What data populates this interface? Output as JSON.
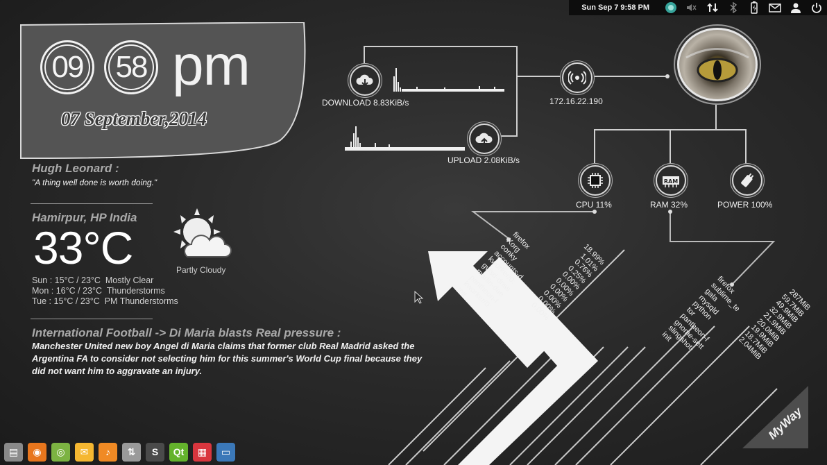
{
  "panel": {
    "clock": "Sun Sep  7  9:58 PM",
    "icons": [
      "app-indicator-icon",
      "volume-icon",
      "network-icon",
      "bluetooth-icon",
      "battery-icon",
      "mail-icon",
      "user-icon",
      "power-icon"
    ]
  },
  "clock": {
    "hour": "09",
    "minute": "58",
    "ampm": "pm",
    "date": "07 September,2014"
  },
  "quote": {
    "author": "Hugh Leonard :",
    "text": "\"A thing well done is worth doing.\""
  },
  "weather": {
    "location": "Hamirpur, HP India",
    "temperature": "33°C",
    "condition": "Partly Cloudy",
    "forecast": [
      "Sun : 15°C / 23°C  Mostly Clear",
      "Mon : 16°C / 23°C  Thunderstorms",
      "Tue : 15°C / 23°C  PM Thunderstorms"
    ]
  },
  "news": {
    "title": "International Football -> Di Maria blasts Real pressure  :",
    "body": "Manchester United new boy Angel di Maria claims that former club Real Madrid asked the Argentina FA to consider not selecting him for this summer's World Cup final because they did not want him to aggravate an injury."
  },
  "network": {
    "download": "DOWNLOAD 8.83KiB/s",
    "upload": "UPLOAD 2.08KiB/s",
    "ip": "172.16.22.190"
  },
  "system": {
    "cpu": "CPU 11%",
    "ram": "RAM 32%",
    "power": "POWER 100%"
  },
  "cpu_processes": {
    "names": [
      "firefox",
      "Xorg",
      "conky",
      "accounts-d",
      "kworker/0:",
      "gvfsd-dnss",
      "marlin-dae",
      "pantheon-f",
      "kworker/0:",
      "init"
    ],
    "values": [
      "18.99%",
      "1.01%",
      "0.76%",
      "0.25%",
      "0.00%",
      "0.00%",
      "0.00%",
      "0.00%",
      "0.00%",
      "0.00%"
    ]
  },
  "ram_processes": {
    "names": [
      "firefox",
      "sublime_te",
      "gala",
      "mysqld",
      "python",
      "tor",
      "pantheon-f",
      "gnome-sett",
      "slingshot-",
      "init"
    ],
    "values": [
      "287MiB",
      "59.7MiB",
      "49.9MiB",
      "32.9MiB",
      "21.9MiB",
      "20.0MiB",
      "19.9MiB",
      "18.7MiB",
      "2.04MiB",
      ""
    ]
  },
  "dock": [
    {
      "name": "files",
      "symbol": "▤",
      "color": "#8a8a8a"
    },
    {
      "name": "firefox",
      "symbol": "◉",
      "color": "#e8761d"
    },
    {
      "name": "web",
      "symbol": "◎",
      "color": "#7cb342"
    },
    {
      "name": "mail",
      "symbol": "✉",
      "color": "#f5b731"
    },
    {
      "name": "music",
      "symbol": "♪",
      "color": "#f08a24"
    },
    {
      "name": "settings",
      "symbol": "⇅",
      "color": "#9a9a9a"
    },
    {
      "name": "sublime",
      "symbol": "S",
      "color": "#4a4a4a"
    },
    {
      "name": "qt",
      "symbol": "Qt",
      "color": "#64b32c"
    },
    {
      "name": "calendar",
      "symbol": "▦",
      "color": "#d9363e"
    },
    {
      "name": "display",
      "symbol": "▭",
      "color": "#3b78b8"
    }
  ],
  "brand": "MyWay"
}
